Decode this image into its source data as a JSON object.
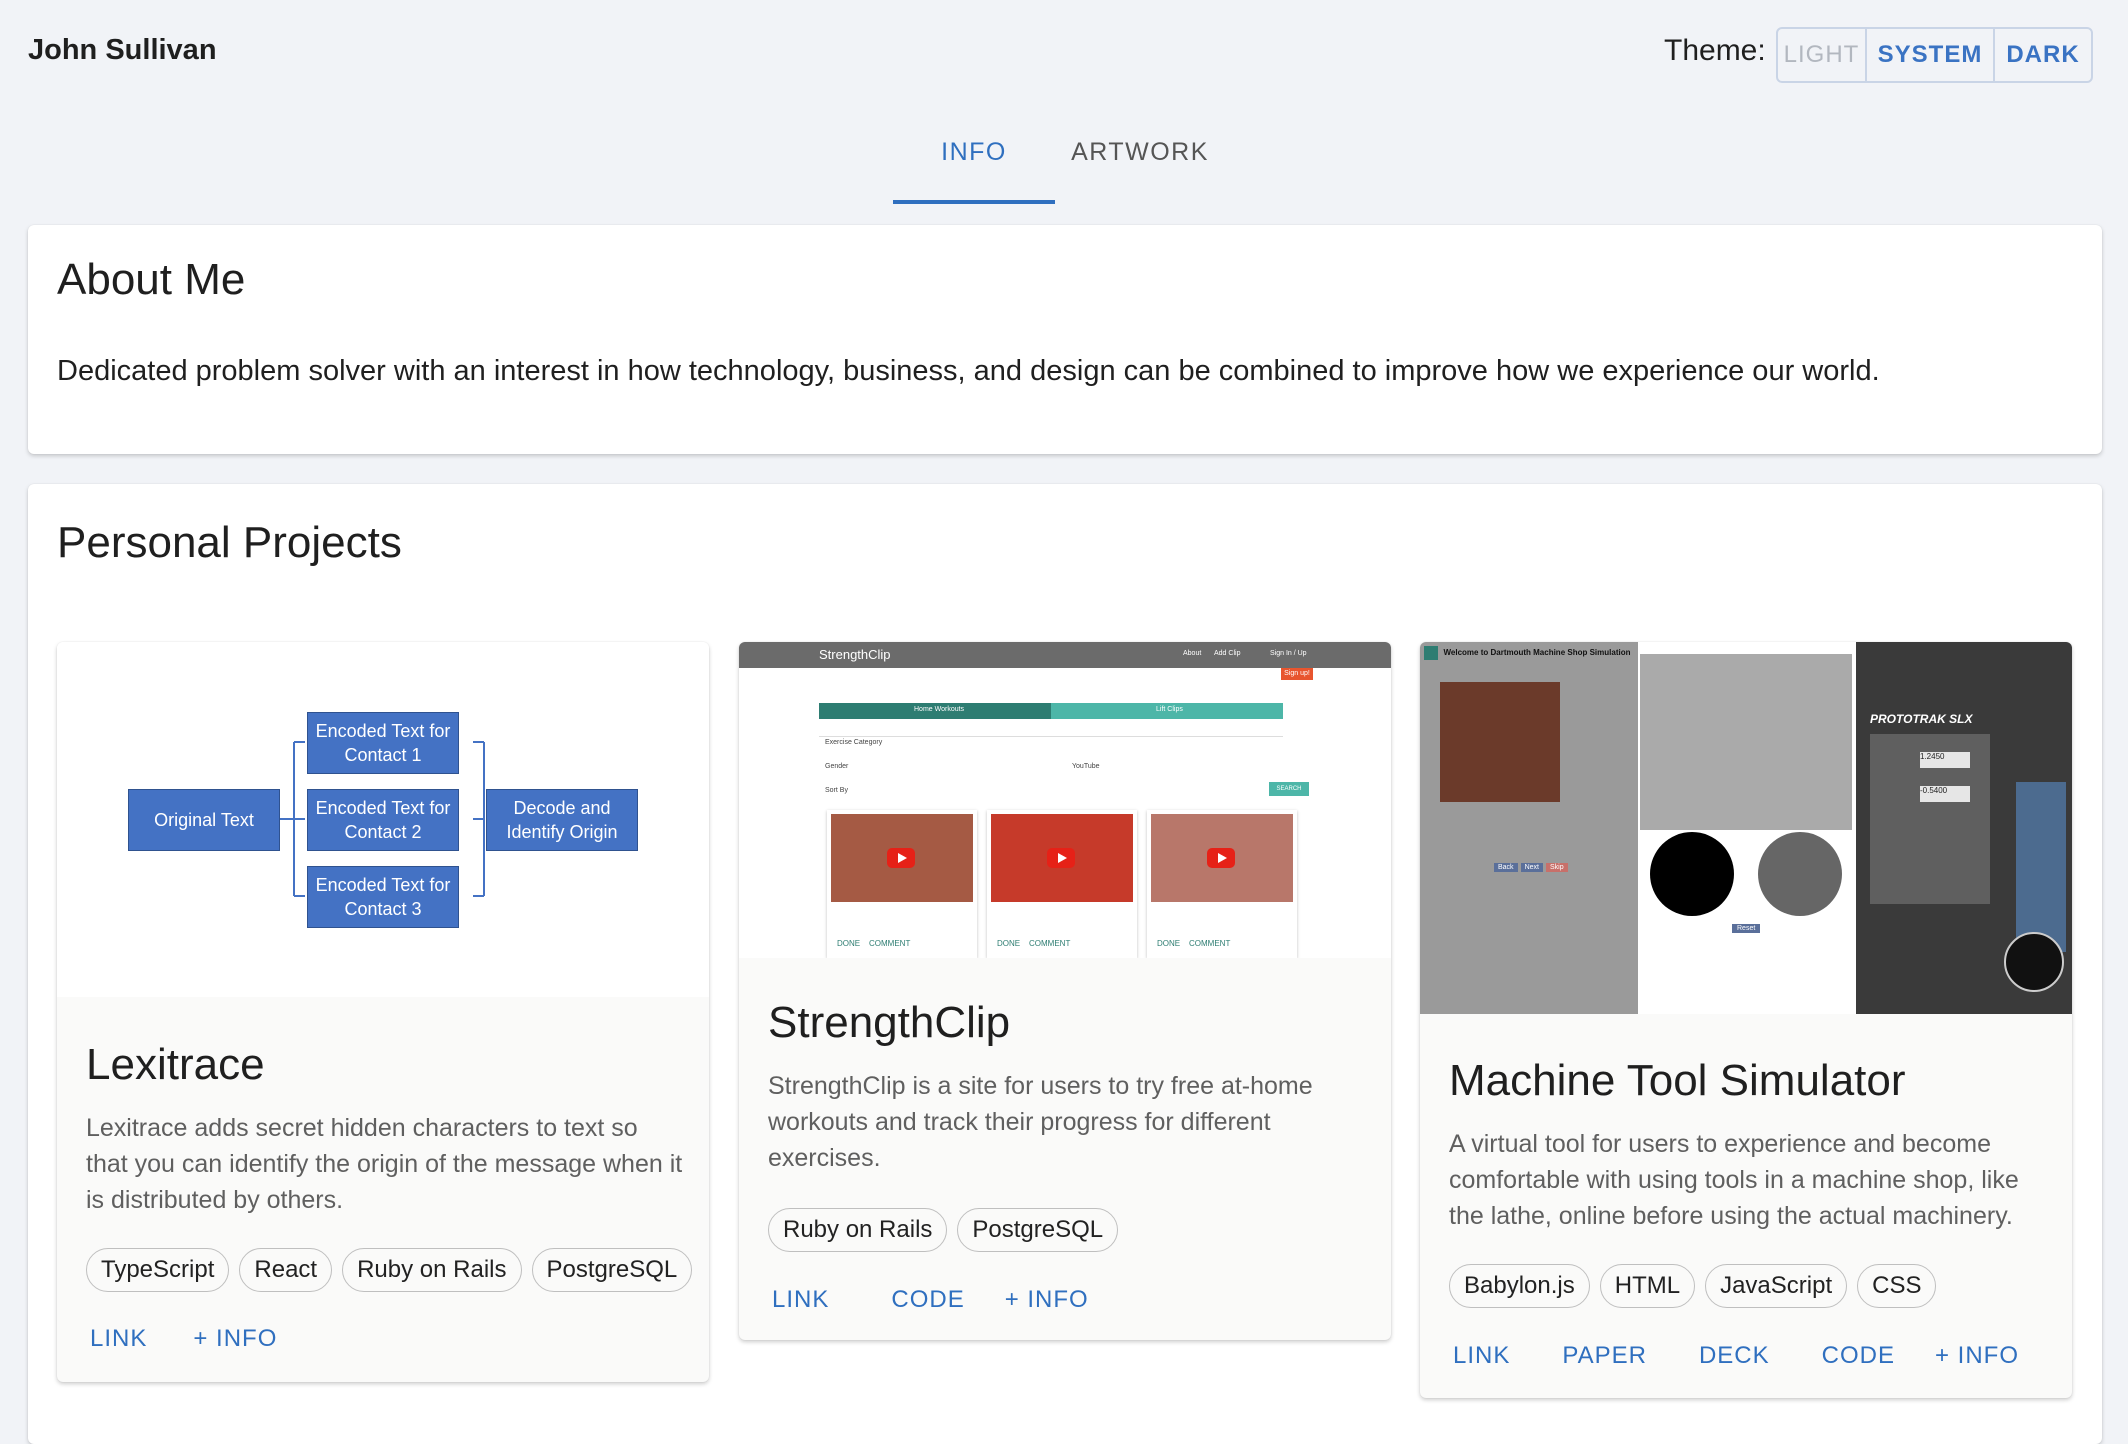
{
  "header": {
    "owner_name": "John Sullivan",
    "theme_label": "Theme:",
    "theme_options": [
      "LIGHT",
      "SYSTEM",
      "DARK"
    ],
    "theme_selected": "SYSTEM"
  },
  "tabs": {
    "items": [
      "INFO",
      "ARTWORK"
    ],
    "active": "INFO"
  },
  "about": {
    "title": "About Me",
    "text": "Dedicated problem solver with an interest in how technology, business, and design can be combined to improve how we experience our world."
  },
  "projects": {
    "title": "Personal Projects",
    "items": [
      {
        "name": "Lexitrace",
        "description": "Lexitrace adds secret hidden characters to text so that you can identify the origin of the message when it is distributed by others.",
        "tags": [
          "TypeScript",
          "React",
          "Ruby on Rails",
          "PostgreSQL"
        ],
        "actions": [
          "LINK",
          "+ INFO"
        ],
        "diagram": {
          "source": "Original Text",
          "encoded": [
            "Encoded Text for Contact 1",
            "Encoded Text for Contact 2",
            "Encoded Text for Contact 3"
          ],
          "result": "Decode and Identify Origin"
        }
      },
      {
        "name": "StrengthClip",
        "description": "StrengthClip is a site for users to try free at-home workouts and track their progress for different exercises.",
        "tags": [
          "Ruby on Rails",
          "PostgreSQL"
        ],
        "actions": [
          "LINK",
          "CODE",
          "+ INFO"
        ],
        "preview": {
          "brand": "StrengthClip",
          "nav": [
            "About",
            "Add Clip",
            "Sign In / Up"
          ],
          "signup": "Sign up!",
          "tabs": [
            "Home Workouts",
            "Lift Clips"
          ],
          "filters": [
            "Exercise Category",
            "Gender",
            "YouTube",
            "Sort By"
          ],
          "search": "SEARCH"
        }
      },
      {
        "name": "Machine Tool Simulator",
        "description": "A virtual tool for users to experience and become comfortable with using tools in a machine shop, like the lathe, online before using the actual machinery.",
        "tags": [
          "Babylon.js",
          "HTML",
          "JavaScript",
          "CSS"
        ],
        "actions": [
          "LINK",
          "PAPER",
          "DECK",
          "CODE",
          "+ INFO"
        ],
        "preview": {
          "welcome": "Welcome to Dartmouth Machine Shop Simulation",
          "buttons": [
            "Back",
            "Next",
            "Skip"
          ],
          "panel_brand": "PROTOTRAK SLX",
          "x_readout": "1.2450",
          "z_readout": "-0.5400",
          "reset": "Reset"
        }
      }
    ]
  },
  "colors": {
    "accent": "#2f6fbf",
    "background": "#f1f3f7",
    "diagram_box": "#4472c4"
  }
}
